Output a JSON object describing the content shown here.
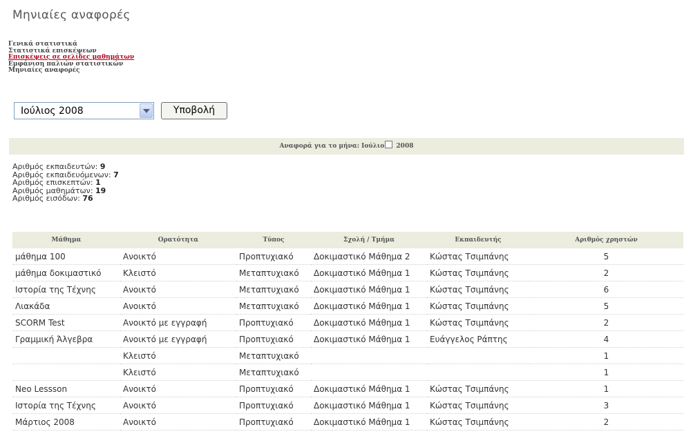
{
  "page_title": "Μηνιαίες αναφορές",
  "nav_links": [
    {
      "label": "Γενικά στατιστικά",
      "active": false
    },
    {
      "label": "Στατιστικά επισκέψεων",
      "active": false
    },
    {
      "label": "Επισκέψεις σε σελίδες μαθημάτων",
      "active": true
    },
    {
      "label": "Εμφάνιση παλιών στατιστικών",
      "active": false
    },
    {
      "label": "Μηνιαίες αναφορές",
      "active": false
    }
  ],
  "month_select": {
    "value": "Ιούλιος 2008"
  },
  "submit_label": "Υποβολή",
  "report_header": {
    "prefix": "Αναφορά για το μήνα: Ιούλιο",
    "year": "2008"
  },
  "stats": [
    {
      "label": "Αριθμός εκπαιδευτών:",
      "value": "9"
    },
    {
      "label": "Αριθμός εκπαιδευόμενων:",
      "value": "7"
    },
    {
      "label": "Αριθμός επισκεπτών:",
      "value": "1"
    },
    {
      "label": "Αριθμός μαθημάτων:",
      "value": "19"
    },
    {
      "label": "Αριθμός εισόδων:",
      "value": "76"
    }
  ],
  "table": {
    "headers": [
      "Μάθημα",
      "Ορατότητα",
      "Τύπος",
      "Σχολή / Τμήμα",
      "Εκπαιδευτής",
      "Αριθμός χρηστών"
    ],
    "rows": [
      [
        "μάθημα 100",
        "Ανοικτό",
        "Προπτυχιακό",
        "Δοκιμαστικό Μάθημα 2",
        "Κώστας Τσιμπάνης",
        "5"
      ],
      [
        "μάθημα δοκιμαστικό",
        "Κλειστό",
        "Μεταπτυχιακό",
        "Δοκιμαστικό Μάθημα 1",
        "Κώστας Τσιμπάνης",
        "2"
      ],
      [
        "Ιστορία της Τέχνης",
        "Ανοικτό",
        "Μεταπτυχιακό",
        "Δοκιμαστικό Μάθημα 1",
        "Κώστας Τσιμπάνης",
        "6"
      ],
      [
        "Λιακάδα",
        "Ανοικτό",
        "Μεταπτυχιακό",
        "Δοκιμαστικό Μάθημα 1",
        "Κώστας Τσιμπάνης",
        "5"
      ],
      [
        "SCORM Test",
        "Ανοικτό με εγγραφή",
        "Προπτυχιακό",
        "Δοκιμαστικό Μάθημα 1",
        "Κώστας Τσιμπάνης",
        "2"
      ],
      [
        "Γραμμική Άλγεβρα",
        "Ανοικτό με εγγραφή",
        "Προπτυχιακό",
        "Δοκιμαστικό Μάθημα 1",
        "Ευάγγελος Ράπτης",
        "4"
      ],
      [
        "",
        "Κλειστό",
        "Μεταπτυχιακό",
        "",
        "",
        "1"
      ],
      [
        "",
        "Κλειστό",
        "Μεταπτυχιακό",
        "",
        "",
        "1"
      ],
      [
        "Neo Lessson",
        "Ανοικτό",
        "Προπτυχιακό",
        "Δοκιμαστικό Μάθημα 1",
        "Κώστας Τσιμπάνης",
        "1"
      ],
      [
        "Ιστορία της Τέχνης",
        "Ανοικτό",
        "Προπτυχιακό",
        "Δοκιμαστικό Μάθημα 1",
        "Κώστας Τσιμπάνης",
        "3"
      ],
      [
        "Μάρτιος 2008",
        "Ανοικτό",
        "Προπτυχιακό",
        "Δοκιμαστικό Μάθημα 1",
        "Κώστας Τσιμπάνης",
        "2"
      ]
    ]
  }
}
